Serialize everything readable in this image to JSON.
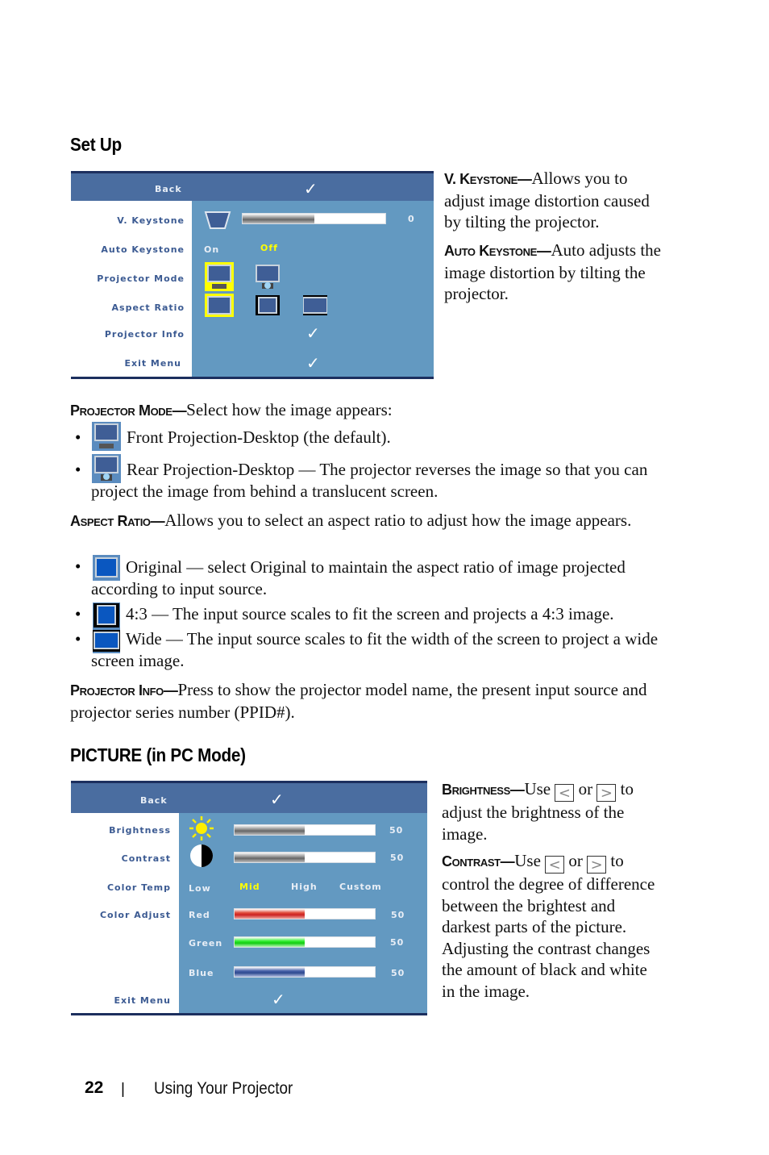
{
  "setup": {
    "heading": "Set Up",
    "osd": {
      "back_label": "Back",
      "rows": [
        {
          "label": "V. Keystone",
          "value": "0",
          "slider_percent": 50
        },
        {
          "label": "Auto Keystone",
          "options": [
            "On",
            "Off"
          ],
          "selected": "Off"
        },
        {
          "label": "Projector Mode",
          "options": [
            "Front Projection-Desktop",
            "Rear Projection-Desktop"
          ],
          "selected": "Front Projection-Desktop"
        },
        {
          "label": "Aspect Ratio",
          "options": [
            "Original",
            "4:3",
            "Wide"
          ],
          "selected": "Original"
        },
        {
          "label": "Projector Info"
        },
        {
          "label": "Exit Menu"
        }
      ],
      "check_glyph": "✓"
    },
    "v_keystone": {
      "term": "V. Keystone—",
      "text": "Allows you to adjust image distortion caused by tilting the projector."
    },
    "auto_keystone": {
      "term": "Auto Keystone—",
      "text": "Auto adjusts the image distortion by tilting the projector."
    },
    "projector_mode": {
      "term": "Projector Mode—",
      "text": "Select how the image appears:",
      "items": [
        {
          "text": "Front Projection-Desktop (the default)."
        },
        {
          "text": "Rear Projection-Desktop — The projector reverses the image so that you can project the image from behind a translucent screen."
        }
      ]
    },
    "aspect_ratio": {
      "term": "Aspect Ratio—",
      "text": "Allows you to select an aspect ratio to adjust how the image appears.",
      "items": [
        {
          "text": "Original — select Original to maintain the aspect ratio of image projected according to input source."
        },
        {
          "text": "4:3 — The input source scales to fit the screen and projects a 4:3 image."
        },
        {
          "text": "Wide — The input source scales to fit the width of the screen to project a wide screen image."
        }
      ]
    },
    "projector_info": {
      "term": "Projector Info—",
      "text": "Press to show the projector model name, the present input source and projector series number (PPID#)."
    }
  },
  "picture": {
    "heading": "PICTURE (in PC Mode)",
    "osd": {
      "back_label": "Back",
      "brightness": {
        "label": "Brightness",
        "value": "50",
        "percent": 50
      },
      "contrast": {
        "label": "Contrast",
        "value": "50",
        "percent": 50
      },
      "color_temp": {
        "label": "Color Temp",
        "options": [
          "Low",
          "Mid",
          "High",
          "Custom"
        ],
        "selected": "Mid"
      },
      "color_adjust": {
        "label": "Color Adjust",
        "channels": [
          {
            "name": "Red",
            "value": "50",
            "percent": 50
          },
          {
            "name": "Green",
            "value": "50",
            "percent": 50
          },
          {
            "name": "Blue",
            "value": "50",
            "percent": 50
          }
        ]
      },
      "exit_label": "Exit Menu",
      "check_glyph": "✓"
    },
    "brightness": {
      "term": "Brightness—",
      "use": "Use",
      "or": "or",
      "to": "to",
      "text": "adjust the brightness of the image.",
      "left_key": "<",
      "right_key": ">"
    },
    "contrast": {
      "term": "Contrast—",
      "use": "Use",
      "or": "or",
      "to": "to",
      "text": "control the degree of difference between the brightest and darkest parts of the picture. Adjusting the contrast changes the amount of black and white in the image.",
      "left_key": "<",
      "right_key": ">"
    }
  },
  "footer": {
    "page_number": "22",
    "separator": "|",
    "section": "Using Your Projector"
  }
}
